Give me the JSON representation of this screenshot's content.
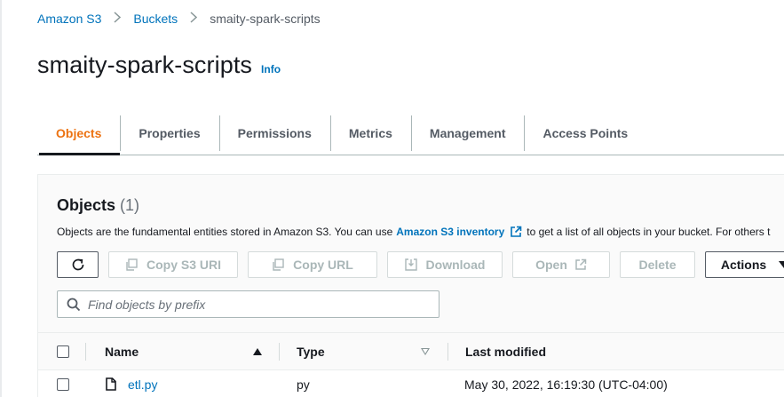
{
  "breadcrumb": {
    "items": [
      {
        "label": "Amazon S3"
      },
      {
        "label": "Buckets"
      },
      {
        "label": "smaity-spark-scripts"
      }
    ]
  },
  "header": {
    "title": "smaity-spark-scripts",
    "info_label": "Info"
  },
  "tabs": [
    {
      "label": "Objects",
      "active": true
    },
    {
      "label": "Properties"
    },
    {
      "label": "Permissions"
    },
    {
      "label": "Metrics"
    },
    {
      "label": "Management"
    },
    {
      "label": "Access Points"
    }
  ],
  "objects_panel": {
    "title": "Objects",
    "count": "(1)",
    "description_prefix": "Objects are the fundamental entities stored in Amazon S3. You can use",
    "description_link": "Amazon S3 inventory",
    "description_suffix": "to get a list of all objects in your bucket. For others t",
    "toolbar": {
      "refresh_icon": "refresh-icon",
      "copy_s3_uri_label": "Copy S3 URI",
      "copy_url_label": "Copy URL",
      "download_label": "Download",
      "open_label": "Open",
      "delete_label": "Delete",
      "actions_label": "Actions"
    },
    "search": {
      "placeholder": "Find objects by prefix",
      "value": ""
    },
    "table": {
      "columns": [
        {
          "label": "Name",
          "sort": "ascending"
        },
        {
          "label": "Type",
          "sort": "sortable"
        },
        {
          "label": "Last modified"
        }
      ],
      "rows": [
        {
          "name": "etl.py",
          "type": "py",
          "last_modified": "May 30, 2022, 16:19:30 (UTC-04:00)",
          "icon": "file-icon"
        }
      ]
    }
  },
  "colors": {
    "link": "#0073bb",
    "active_tab": "#ec7211",
    "text": "#16191f",
    "disabled": "#aab7b8"
  }
}
